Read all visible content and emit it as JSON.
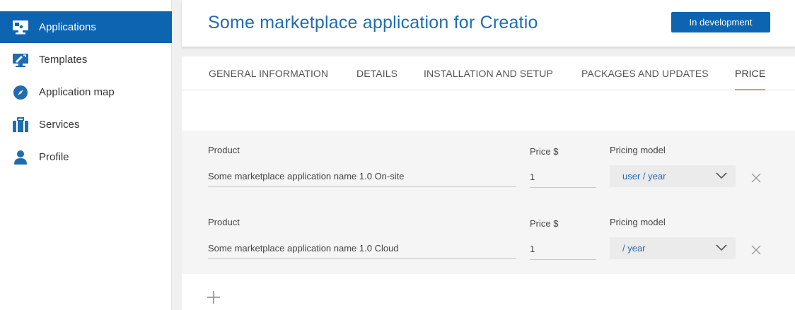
{
  "sidebar": {
    "items": [
      {
        "label": "Applications",
        "icon": "monitor-icon",
        "active": true
      },
      {
        "label": "Templates",
        "icon": "templates-icon",
        "active": false
      },
      {
        "label": "Application map",
        "icon": "compass-icon",
        "active": false
      },
      {
        "label": "Services",
        "icon": "briefcase-icon",
        "active": false
      },
      {
        "label": "Profile",
        "icon": "user-icon",
        "active": false
      }
    ]
  },
  "header": {
    "title": "Some marketplace application for Creatio",
    "status_label": "In development"
  },
  "tabs": [
    {
      "label": "GENERAL INFORMATION",
      "active": false
    },
    {
      "label": "DETAILS",
      "active": false
    },
    {
      "label": "INSTALLATION AND SETUP",
      "active": false
    },
    {
      "label": "PACKAGES AND UPDATES",
      "active": false
    },
    {
      "label": "PRICE",
      "active": true
    }
  ],
  "price": {
    "rows": [
      {
        "product_label": "Product",
        "product_value": "Some marketplace application name 1.0 On-site",
        "price_label": "Price $",
        "price_value": "1",
        "model_label": "Pricing model",
        "model_value": "user / year"
      },
      {
        "product_label": "Product",
        "product_value": "Some marketplace application name 1.0 Cloud",
        "price_label": "Price $",
        "price_value": "1",
        "model_label": "Pricing model",
        "model_value": "/ year"
      }
    ]
  },
  "colors": {
    "accent": "#0d64b0",
    "title": "#1f6cb0",
    "tab_underline": "#c8a36a"
  }
}
